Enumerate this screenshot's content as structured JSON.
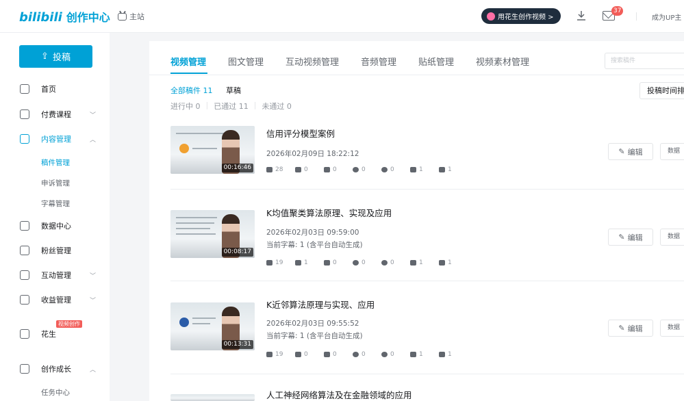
{
  "header": {
    "logo_bili": "bilibili",
    "logo_title": "创作中心",
    "home_label": "主站",
    "huasheng_label": "用花生创作视频 >",
    "message_count": "37",
    "become_up_label": "成为UP主"
  },
  "sidebar": {
    "post_label": "投稿",
    "items": [
      {
        "label": "首页"
      },
      {
        "label": "付费课程"
      },
      {
        "label": "内容管理"
      },
      {
        "label": "数据中心"
      },
      {
        "label": "粉丝管理"
      },
      {
        "label": "互动管理"
      },
      {
        "label": "收益管理"
      },
      {
        "label": "花生"
      },
      {
        "label": "创作成长"
      }
    ],
    "content_sub": [
      "稿件管理",
      "申诉管理",
      "字幕管理"
    ],
    "growth_sub": [
      "任务中心"
    ],
    "huasheng_tag": "视频创作"
  },
  "main": {
    "tabs": [
      "视频管理",
      "图文管理",
      "互动视频管理",
      "音频管理",
      "贴纸管理",
      "视频素材管理"
    ],
    "search_placeholder": "搜索稿件",
    "filter_all": "全部稿件 11",
    "filter_draft": "草稿",
    "status_in_progress": "进行中 0",
    "status_passed": "已通过 11",
    "status_failed": "未通过 0",
    "sort_label": "投稿时间排序",
    "edit_label": "编辑",
    "data_label": "数据",
    "videos": [
      {
        "title": "信用评分模型案例",
        "date": "2026年02月09日 18:22:12",
        "subtitle": "",
        "duration": "00:16:46",
        "stats": [
          "28",
          "0",
          "0",
          "0",
          "0",
          "1",
          "1"
        ]
      },
      {
        "title": "K均值聚类算法原理、实现及应用",
        "date": "2026年02月03日 09:59:00",
        "subtitle": "当前字幕: 1 (含平台自动生成)",
        "duration": "00:08:17",
        "stats": [
          "19",
          "1",
          "0",
          "0",
          "0",
          "1",
          "1"
        ]
      },
      {
        "title": "K近邻算法原理与实现、应用",
        "date": "2026年02月03日 09:55:52",
        "subtitle": "当前字幕: 1 (含平台自动生成)",
        "duration": "00:13:31",
        "stats": [
          "19",
          "0",
          "0",
          "0",
          "0",
          "1",
          "1"
        ]
      },
      {
        "title": "人工神经网络算法及在金融领域的应用",
        "date": "",
        "subtitle": "",
        "duration": "",
        "stats": []
      }
    ]
  }
}
